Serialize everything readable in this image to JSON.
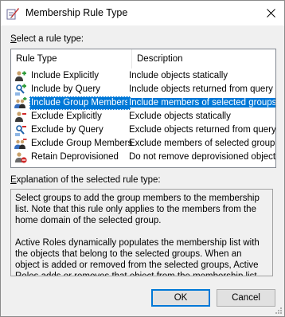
{
  "window": {
    "title": "Membership Rule Type",
    "icon": "membership-rule-icon",
    "close_glyph": "✕"
  },
  "select_label": {
    "accel": "S",
    "rest": "elect a rule type:"
  },
  "list": {
    "columns": [
      "Rule Type",
      "Description"
    ],
    "rows": [
      {
        "name": "Include Explicitly",
        "description": "Include objects statically",
        "icon": "include-explicitly-icon",
        "selected": false
      },
      {
        "name": "Include by Query",
        "description": "Include objects returned from query",
        "icon": "include-by-query-icon",
        "selected": false
      },
      {
        "name": "Include Group Members",
        "description": "Include members of selected groups",
        "icon": "include-group-members-icon",
        "selected": true
      },
      {
        "name": "Exclude Explicitly",
        "description": "Exclude objects statically",
        "icon": "exclude-explicitly-icon",
        "selected": false
      },
      {
        "name": "Exclude by Query",
        "description": "Exclude objects returned from query",
        "icon": "exclude-by-query-icon",
        "selected": false
      },
      {
        "name": "Exclude Group Members",
        "description": "Exclude members of selected groups",
        "icon": "exclude-group-members-icon",
        "selected": false
      },
      {
        "name": "Retain Deprovisioned",
        "description": "Do not remove deprovisioned objects",
        "icon": "retain-deprovisioned-icon",
        "selected": false
      }
    ]
  },
  "explanation_label": {
    "accel": "E",
    "rest": "xplanation of the selected rule type:"
  },
  "explanation": {
    "p1": "Select groups to add the group members to the membership list. Note that this rule only applies to the members from the home domain of the selected group.",
    "p2": "Active Roles dynamically populates the membership list with the objects that belong to the selected groups. When an object is added or removed from the selected groups, Active Roles adds or removes that object from the membership list."
  },
  "buttons": {
    "ok": "OK",
    "cancel": "Cancel"
  },
  "colors": {
    "selection": "#0078d7",
    "dialog_bg": "#f0f0f0",
    "include_green": "#2e9b3a",
    "exclude_red": "#d02a2a"
  }
}
